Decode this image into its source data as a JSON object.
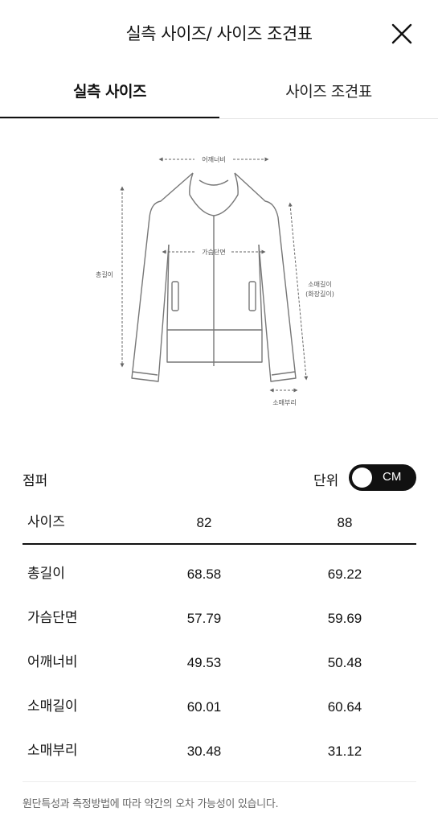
{
  "header": {
    "title": "실측 사이즈/ 사이즈 조견표",
    "close_icon": "close-icon"
  },
  "tabs": [
    {
      "label": "실측 사이즈",
      "active": true
    },
    {
      "label": "사이즈 조견표",
      "active": false
    }
  ],
  "diagram": {
    "garment": "jacket",
    "labels": {
      "shoulder": "어깨너비",
      "chest": "가슴단면",
      "total_length": "총길이",
      "sleeve_length_1": "소매길이",
      "sleeve_length_2": "(화장길이)",
      "cuff": "소매부리"
    }
  },
  "item": {
    "name": "점퍼",
    "unit_label": "단위",
    "unit_value": "CM"
  },
  "table": {
    "headers": [
      "사이즈",
      "82",
      "88"
    ],
    "rows": [
      [
        "총길이",
        "68.58",
        "69.22"
      ],
      [
        "가슴단면",
        "57.79",
        "59.69"
      ],
      [
        "어깨너비",
        "49.53",
        "50.48"
      ],
      [
        "소매길이",
        "60.01",
        "60.64"
      ],
      [
        "소매부리",
        "30.48",
        "31.12"
      ]
    ]
  },
  "note": "원단특성과 측정방법에 따라 약간의 오차 가능성이 있습니다.",
  "colors": {
    "text": "#111111",
    "muted": "#666666",
    "toggle_bg": "#111111",
    "line": "#e3e3e3"
  }
}
